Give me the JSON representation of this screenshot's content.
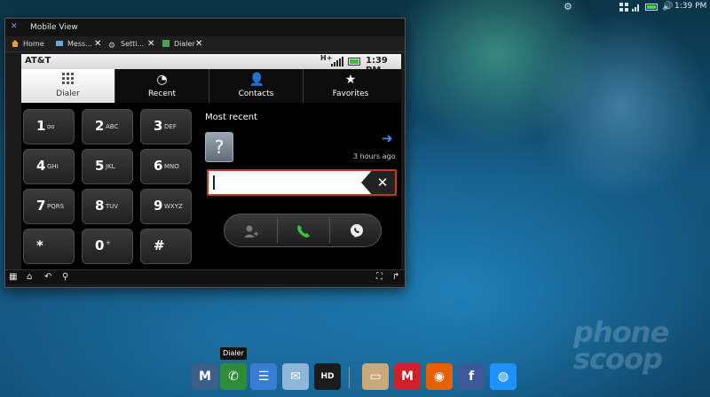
{
  "status_bar": {
    "clock": "1:39 PM",
    "icons": [
      "gear-icon",
      "grid-icon",
      "signal-icon",
      "battery-icon",
      "volume-icon"
    ]
  },
  "window": {
    "title": "Mobile View",
    "tabs": [
      {
        "label": "Home",
        "icon": "home-icon",
        "closable": false
      },
      {
        "label": "Mess...",
        "icon": "messaging-icon",
        "closable": true
      },
      {
        "label": "Setti...",
        "icon": "settings-icon",
        "closable": true
      },
      {
        "label": "Dialer",
        "icon": "dialer-icon",
        "closable": true
      }
    ],
    "close_glyph": "✕"
  },
  "phone": {
    "carrier": "AT&T",
    "network": "H+",
    "time": "1:39 PM",
    "accent_color": "#c0392b",
    "tabs": [
      {
        "label": "Dialer",
        "icon": "keypad-icon",
        "active": true
      },
      {
        "label": "Recent",
        "icon": "recent-icon",
        "active": false
      },
      {
        "label": "Contacts",
        "icon": "contacts-icon",
        "active": false
      },
      {
        "label": "Favorites",
        "icon": "star-icon",
        "active": false
      }
    ],
    "keys": [
      {
        "digit": "1",
        "letters": "oo"
      },
      {
        "digit": "2",
        "letters": "ABC"
      },
      {
        "digit": "3",
        "letters": "DEF"
      },
      {
        "digit": "4",
        "letters": "GHI"
      },
      {
        "digit": "5",
        "letters": "JKL"
      },
      {
        "digit": "6",
        "letters": "MNO"
      },
      {
        "digit": "7",
        "letters": "PQRS"
      },
      {
        "digit": "8",
        "letters": "TUV"
      },
      {
        "digit": "9",
        "letters": "WXYZ"
      },
      {
        "digit": "*",
        "letters": ""
      },
      {
        "digit": "0",
        "letters": "+"
      },
      {
        "digit": "#",
        "letters": ""
      }
    ],
    "most_recent_label": "Most recent",
    "unknown_contact_glyph": "?",
    "recent_time": "3 hours ago",
    "number_value": "",
    "backspace_glyph": "✕"
  },
  "taskbar": {
    "tooltip": "Dialer",
    "items": [
      {
        "name": "phone-app-icon",
        "glyph": "M",
        "color": "#3b5f86"
      },
      {
        "name": "dialer-app-icon",
        "glyph": "✆",
        "color": "#2e8b3a"
      },
      {
        "name": "contacts-app-icon",
        "glyph": "☰",
        "color": "#3a7bd5"
      },
      {
        "name": "email-app-icon",
        "glyph": "✉",
        "color": "#8fb6d8"
      },
      {
        "name": "hd-app-icon",
        "glyph": "HD",
        "color": "#1b1b1b"
      },
      {
        "name": "folder-app-icon",
        "glyph": "▭",
        "color": "#c9a97a"
      },
      {
        "name": "motorola-app-icon",
        "glyph": "M",
        "color": "#d0202b"
      },
      {
        "name": "firefox-app-icon",
        "glyph": "◉",
        "color": "#e66000"
      },
      {
        "name": "facebook-app-icon",
        "glyph": "f",
        "color": "#3b5998"
      },
      {
        "name": "att-app-icon",
        "glyph": "◍",
        "color": "#1e90ff"
      }
    ]
  },
  "watermark": [
    "phone",
    "scoop"
  ]
}
